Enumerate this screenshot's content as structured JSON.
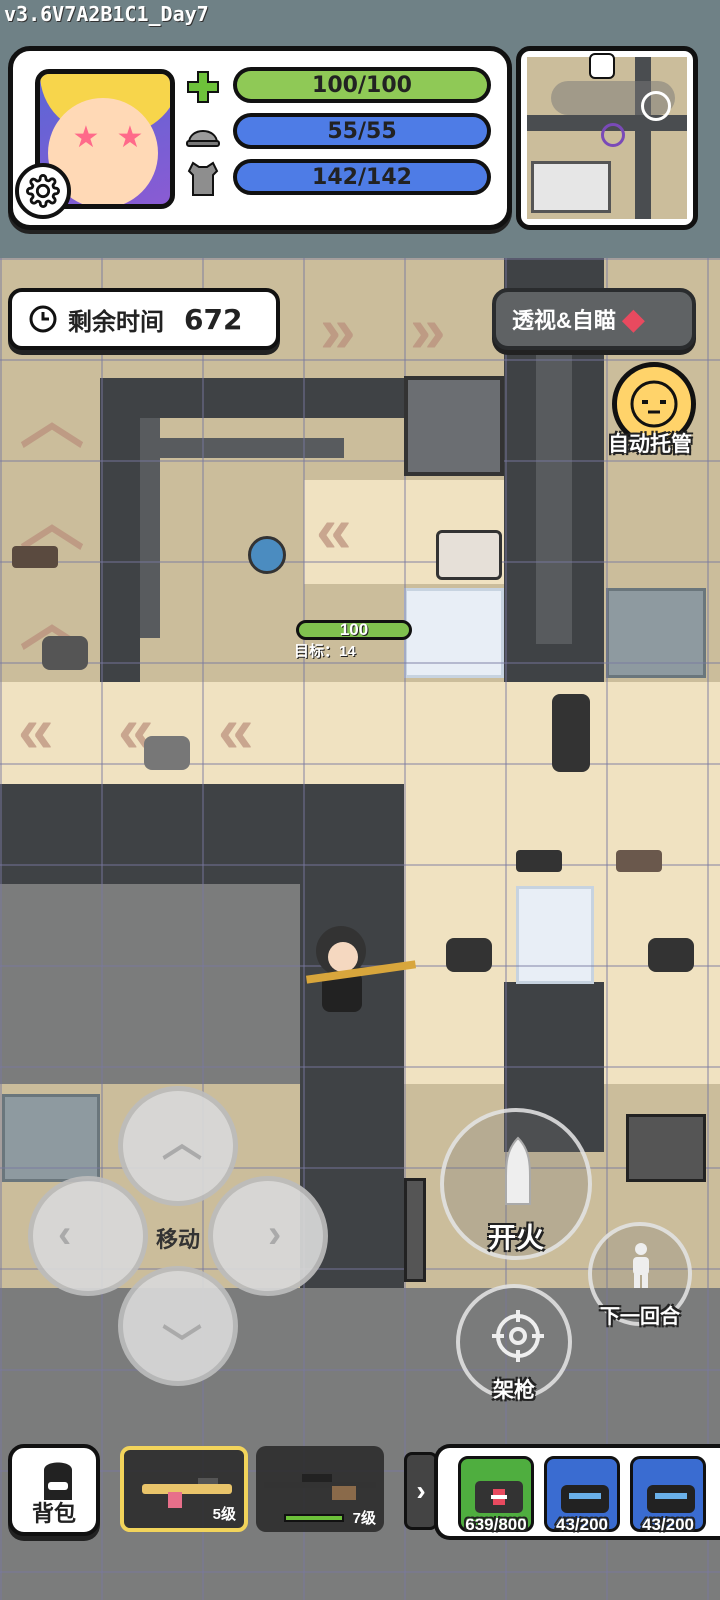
{
  "app": {
    "version": "v3.6V7A2B1C1_Day7"
  },
  "status": {
    "health": {
      "icon": "plus-icon",
      "label": "100/100",
      "fraction": 1.0,
      "color": "#8fc956"
    },
    "helmet": {
      "icon": "helmet-icon",
      "label": "55/55",
      "fraction": 1.0,
      "color": "#4e7ce6"
    },
    "armor": {
      "icon": "vest-icon",
      "label": "142/142",
      "fraction": 1.0,
      "color": "#4e7ce6"
    }
  },
  "hud": {
    "time_label": "剩余时间",
    "time_value": "672",
    "xray_label": "透视&自瞄",
    "auto_label": "自动托管"
  },
  "player": {
    "hp": "100",
    "target": "目标：14"
  },
  "controls": {
    "move_label": "移动",
    "fire_label": "开火",
    "next_round_label": "下一回合",
    "aim_label": "架枪"
  },
  "bottom": {
    "bag_label": "背包",
    "weapons": [
      {
        "name": "assault-rifle",
        "level": "5级",
        "selected": true
      },
      {
        "name": "sniper-rifle",
        "level": "7级",
        "selected": false
      }
    ],
    "consumables": [
      {
        "name": "medkit",
        "count": "639/800",
        "color": "#4fae3f"
      },
      {
        "name": "helmet-repair",
        "count": "43/200",
        "color": "#3a6cd1"
      },
      {
        "name": "armor-repair",
        "count": "43/200",
        "color": "#3a6cd1"
      }
    ]
  }
}
